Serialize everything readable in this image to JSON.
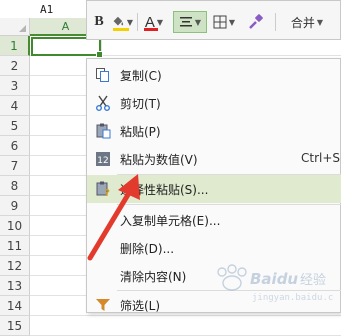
{
  "name_box": {
    "value": "A1"
  },
  "columns": [
    {
      "label": "A"
    }
  ],
  "rows": [
    "1",
    "2",
    "3",
    "4",
    "5",
    "6",
    "7",
    "8",
    "9",
    "10",
    "11",
    "12",
    "13",
    "14",
    "15"
  ],
  "toolbar": {
    "bold_label": "B",
    "font_color_label": "A",
    "merge_label": "合并",
    "fill_color": "#f5d000",
    "font_color": "#e02020"
  },
  "context_menu": {
    "items": [
      {
        "label": "复制(C)",
        "icon": "copy-icon"
      },
      {
        "label": "剪切(T)",
        "icon": "scissors-icon"
      },
      {
        "label": "粘贴(P)",
        "icon": "paste-icon"
      },
      {
        "label": "粘贴为数值(V)",
        "icon": "paste-values-icon",
        "shortcut": "Ctrl+Sh"
      },
      {
        "label": "选择性粘贴(S)...",
        "icon": "paste-special-icon",
        "highlighted": true
      },
      {
        "label": "入复制单元格(E)...",
        "icon": ""
      },
      {
        "label": "删除(D)...",
        "icon": ""
      },
      {
        "label": "清除内容(N)",
        "icon": ""
      },
      {
        "label": "筛选(L)",
        "icon": "filter-icon"
      }
    ]
  },
  "colors": {
    "highlight": "#dfeacf",
    "selection_border": "#3f8a2c",
    "arrow": "#e23b2e"
  },
  "watermark": {
    "text": "Baidu 经验"
  }
}
